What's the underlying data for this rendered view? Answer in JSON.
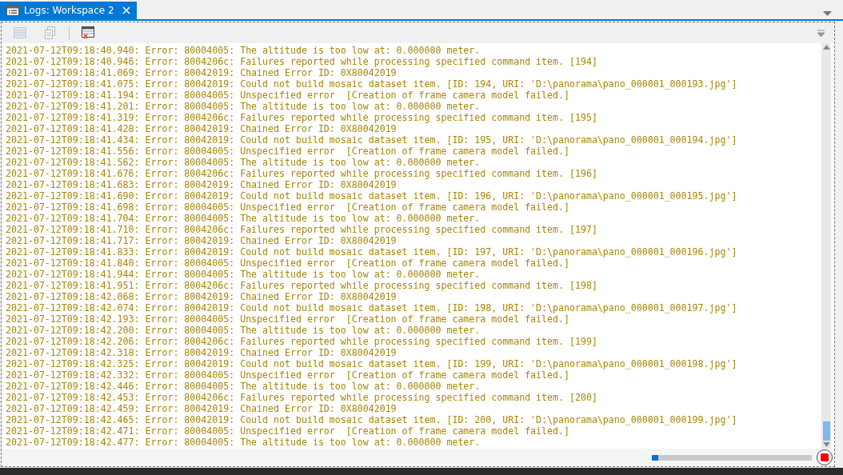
{
  "tab": {
    "title": "Logs: Workspace 2",
    "selected": true
  },
  "toolbar": [
    {
      "kind": "list",
      "disabled": true
    },
    {
      "kind": "copy",
      "disabled": true
    },
    {
      "kind": "clear",
      "disabled": false
    }
  ],
  "log_lines": [
    "2021-07-12T09:18:40.940: Error: 80004005: The altitude is too low at: 0.000000 meter.",
    "2021-07-12T09:18:40.946: Error: 8004206c: Failures reported while processing specified command item. [194]",
    "2021-07-12T09:18:41.069: Error: 80042019: Chained Error ID: 0X80042019",
    "2021-07-12T09:18:41.075: Error: 80042019: Could not build mosaic dataset item. [ID: 194, URI: 'D:\\panorama\\pano_000001_000193.jpg']",
    "2021-07-12T09:18:41.194: Error: 80004005: Unspecified error  [Creation of frame camera model failed.]",
    "2021-07-12T09:18:41.201: Error: 80004005: The altitude is too low at: 0.000000 meter.",
    "2021-07-12T09:18:41.319: Error: 8004206c: Failures reported while processing specified command item. [195]",
    "2021-07-12T09:18:41.428: Error: 80042019: Chained Error ID: 0X80042019",
    "2021-07-12T09:18:41.434: Error: 80042019: Could not build mosaic dataset item. [ID: 195, URI: 'D:\\panorama\\pano_000001_000194.jpg']",
    "2021-07-12T09:18:41.556: Error: 80004005: Unspecified error  [Creation of frame camera model failed.]",
    "2021-07-12T09:18:41.562: Error: 80004005: The altitude is too low at: 0.000000 meter.",
    "2021-07-12T09:18:41.676: Error: 8004206c: Failures reported while processing specified command item. [196]",
    "2021-07-12T09:18:41.683: Error: 80042019: Chained Error ID: 0X80042019",
    "2021-07-12T09:18:41.690: Error: 80042019: Could not build mosaic dataset item. [ID: 196, URI: 'D:\\panorama\\pano_000001_000195.jpg']",
    "2021-07-12T09:18:41.698: Error: 80004005: Unspecified error  [Creation of frame camera model failed.]",
    "2021-07-12T09:18:41.704: Error: 80004005: The altitude is too low at: 0.000000 meter.",
    "2021-07-12T09:18:41.710: Error: 8004206c: Failures reported while processing specified command item. [197]",
    "2021-07-12T09:18:41.717: Error: 80042019: Chained Error ID: 0X80042019",
    "2021-07-12T09:18:41.833: Error: 80042019: Could not build mosaic dataset item. [ID: 197, URI: 'D:\\panorama\\pano_000001_000196.jpg']",
    "2021-07-12T09:18:41.840: Error: 80004005: Unspecified error  [Creation of frame camera model failed.]",
    "2021-07-12T09:18:41.944: Error: 80004005: The altitude is too low at: 0.000000 meter.",
    "2021-07-12T09:18:41.951: Error: 8004206c: Failures reported while processing specified command item. [198]",
    "2021-07-12T09:18:42.068: Error: 80042019: Chained Error ID: 0X80042019",
    "2021-07-12T09:18:42.074: Error: 80042019: Could not build mosaic dataset item. [ID: 198, URI: 'D:\\panorama\\pano_000001_000197.jpg']",
    "2021-07-12T09:18:42.193: Error: 80004005: Unspecified error  [Creation of frame camera model failed.]",
    "2021-07-12T09:18:42.200: Error: 80004005: The altitude is too low at: 0.000000 meter.",
    "2021-07-12T09:18:42.206: Error: 8004206c: Failures reported while processing specified command item. [199]",
    "2021-07-12T09:18:42.318: Error: 80042019: Chained Error ID: 0X80042019",
    "2021-07-12T09:18:42.325: Error: 80042019: Could not build mosaic dataset item. [ID: 199, URI: 'D:\\panorama\\pano_000001_000198.jpg']",
    "2021-07-12T09:18:42.332: Error: 80004005: Unspecified error  [Creation of frame camera model failed.]",
    "2021-07-12T09:18:42.446: Error: 80004005: The altitude is too low at: 0.000000 meter.",
    "2021-07-12T09:18:42.453: Error: 8004206c: Failures reported while processing specified command item. [200]",
    "2021-07-12T09:18:42.459: Error: 80042019: Chained Error ID: 0X80042019",
    "2021-07-12T09:18:42.465: Error: 80042019: Could not build mosaic dataset item. [ID: 200, URI: 'D:\\panorama\\pano_000001_000199.jpg']",
    "2021-07-12T09:18:42.471: Error: 80004005: Unspecified error  [Creation of frame camera model failed.]",
    "2021-07-12T09:18:42.477: Error: 80004005: The altitude is too low at: 0.000000 meter."
  ],
  "progress": {
    "level": 0.04
  }
}
